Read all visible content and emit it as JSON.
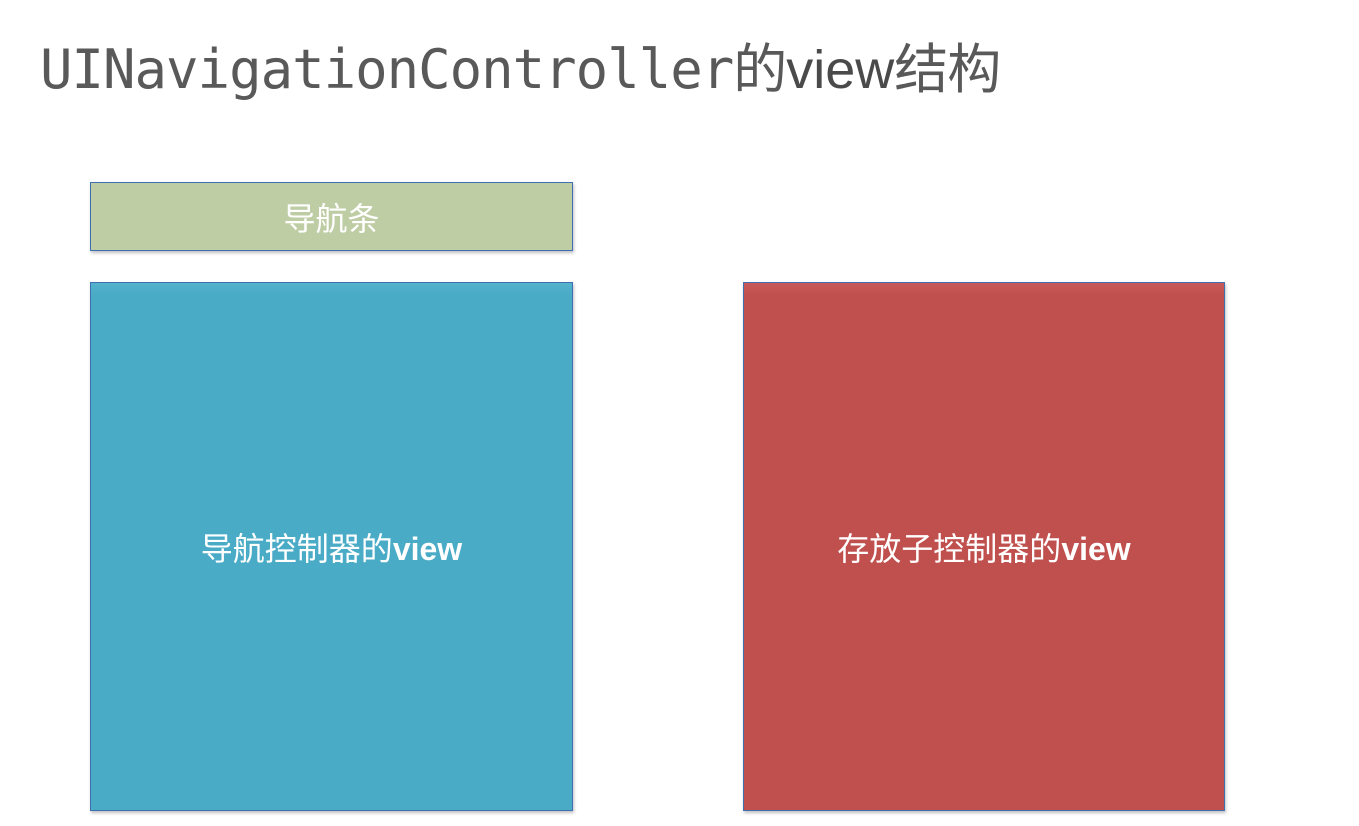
{
  "title": {
    "prefix": "UINavigationController的",
    "strong": "view",
    "suffix": "结构"
  },
  "boxes": {
    "navigation_bar": {
      "label": "导航条",
      "color": "#bfcda5"
    },
    "nav_controller_view": {
      "label_prefix": "导航控制器的",
      "label_strong": "view",
      "color": "#4aabc6"
    },
    "child_controller_view": {
      "label_prefix": "存放子控制器的",
      "label_strong": "view",
      "color": "#c0504e"
    }
  }
}
